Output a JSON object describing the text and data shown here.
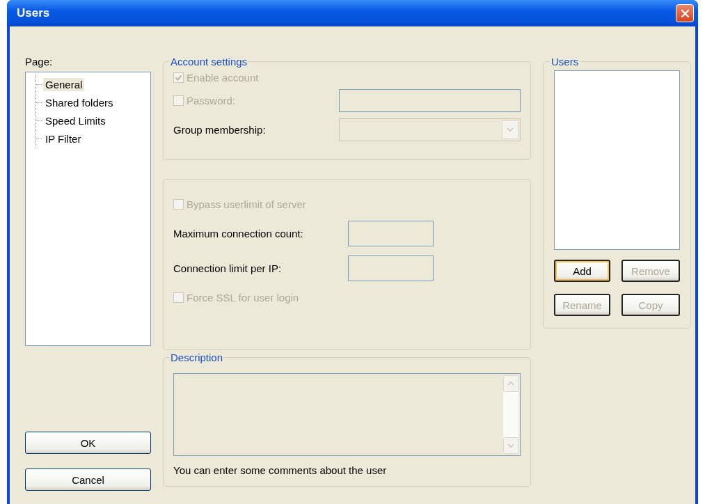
{
  "window": {
    "title": "Users"
  },
  "page_tree": {
    "label": "Page:",
    "items": [
      {
        "label": "General",
        "selected": true
      },
      {
        "label": "Shared folders",
        "selected": false
      },
      {
        "label": "Speed Limits",
        "selected": false
      },
      {
        "label": "IP Filter",
        "selected": false
      }
    ]
  },
  "account_settings": {
    "title": "Account settings",
    "rows": [
      {
        "kind": "checkbox",
        "label": "Enable account",
        "checked": true,
        "disabled": true
      },
      {
        "kind": "checkbox_field",
        "label": "Password:",
        "checked": false,
        "disabled": true
      },
      {
        "kind": "combo",
        "label": "Group membership:"
      }
    ]
  },
  "limits": {
    "rows": [
      {
        "kind": "checkbox",
        "label": "Bypass userlimit of server",
        "checked": false,
        "disabled": true
      },
      {
        "kind": "field",
        "label": "Maximum connection count:"
      },
      {
        "kind": "field",
        "label": "Connection limit per IP:"
      },
      {
        "kind": "checkbox",
        "label": "Force SSL for user login",
        "checked": false,
        "disabled": true
      }
    ]
  },
  "description": {
    "title": "Description",
    "hint": "You can enter some comments about the user"
  },
  "users": {
    "title": "Users",
    "buttons": [
      {
        "label": "Add",
        "disabled": false,
        "default": true
      },
      {
        "label": "Remove",
        "disabled": true,
        "default": false
      },
      {
        "label": "Rename",
        "disabled": true,
        "default": false
      },
      {
        "label": "Copy",
        "disabled": true,
        "default": false
      }
    ]
  },
  "buttons": [
    {
      "label": "OK"
    },
    {
      "label": "Cancel"
    }
  ]
}
